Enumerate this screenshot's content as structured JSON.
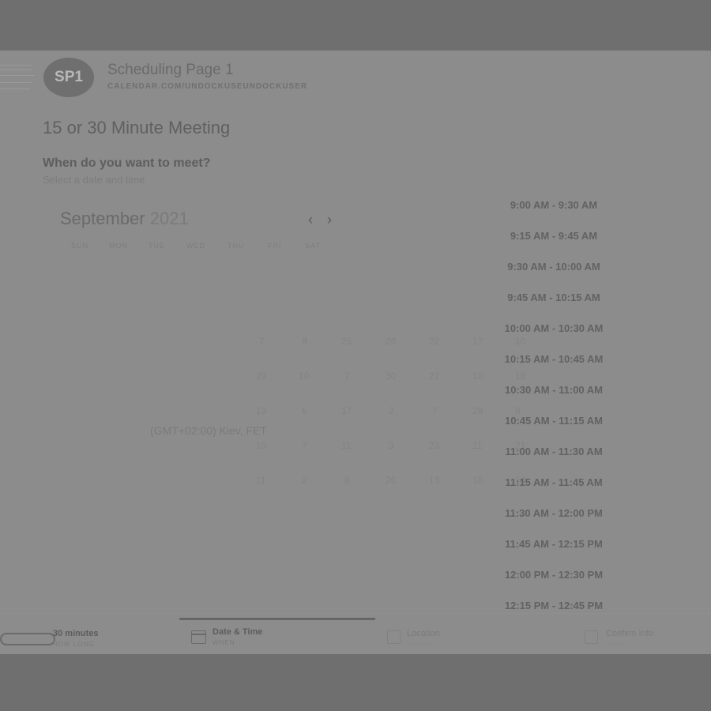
{
  "header": {
    "avatar_initials": "SP1",
    "title": "Scheduling Page 1",
    "url": "CALENDAR.COM/UNDOCKUSEUNDOCKUSER"
  },
  "meeting": {
    "title": "15 or 30 Minute Meeting",
    "question": "When do you want to meet?",
    "subtitle": "Select a date and time"
  },
  "calendar": {
    "month": "September",
    "year": "2021",
    "prev_icon": "‹",
    "next_icon": "›",
    "weekdays": [
      "SUN",
      "MON",
      "TUE",
      "WED",
      "THU",
      "FRI",
      "SAT"
    ],
    "background_numbers": [
      [
        "7",
        "8",
        "25",
        "26",
        "22",
        "17",
        "10"
      ],
      [
        "29",
        "10",
        "7",
        "30",
        "27",
        "10",
        "18"
      ],
      [
        "13",
        "6",
        "17",
        "2",
        "7",
        "28",
        "8"
      ],
      [
        "10",
        "7",
        "11",
        "3",
        "23",
        "11",
        "21"
      ],
      [
        "11",
        "2",
        "8",
        "26",
        "13",
        "10",
        "14"
      ]
    ]
  },
  "timezone": "(GMT+02:00) Kiev, FET",
  "time_slots": [
    "9:00 AM - 9:30 AM",
    "9:15 AM - 9:45 AM",
    "9:30 AM - 10:00 AM",
    "9:45 AM - 10:15 AM",
    "10:00 AM - 10:30 AM",
    "10:15 AM - 10:45 AM",
    "10:30 AM - 11:00 AM",
    "10:45 AM - 11:15 AM",
    "11:00 AM - 11:30 AM",
    "11:15 AM - 11:45 AM",
    "11:30 AM - 12:00 PM",
    "11:45 AM - 12:15 PM",
    "12:00 PM - 12:30 PM",
    "12:15 PM - 12:45 PM"
  ],
  "steps": [
    {
      "label": "30 minutes",
      "sub": "HOW LONG",
      "icon": "duration-pill-icon"
    },
    {
      "label": "Date & Time",
      "sub": "WHEN",
      "icon": "calendar-icon"
    },
    {
      "label": "Location",
      "sub": "WHERE",
      "icon": "location-icon"
    },
    {
      "label": "Confirm Info",
      "sub": "INFO",
      "icon": "confirm-icon"
    }
  ],
  "colors": {
    "overlay_band": "#6f6f6f",
    "panel": "#8c8c8c",
    "active_step_bar": "#666666"
  }
}
